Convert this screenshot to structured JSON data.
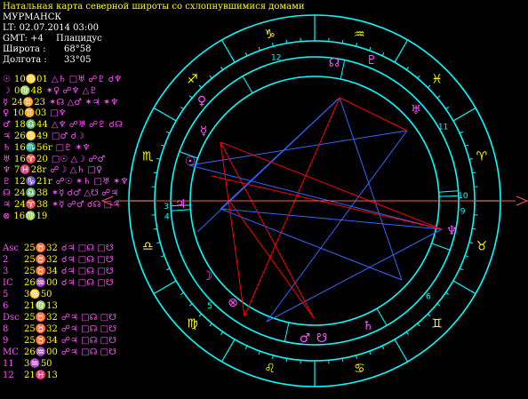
{
  "header": {
    "title": "Натальная карта северной широты со схлопнувшимися домами",
    "city": "МУРМАНСК",
    "local_time": "LT: 02.07.2014  03:00",
    "gmt": "GMT: +4",
    "house_system": "Плацидус",
    "latitude_label": "Широта :",
    "latitude_value": "68°58",
    "longitude_label": "Долгота :",
    "longitude_value": "33°05"
  },
  "planets": [
    {
      "glyph": "☉",
      "pos": "10♋01",
      "aspects": "△♄ □♅ ☍♇ ☌♆",
      "color": "#ff55ff"
    },
    {
      "glyph": "☽",
      "pos": "0♍48",
      "aspects": "✶♀ ☍♆ △♇",
      "color": "#ff55ff"
    },
    {
      "glyph": "☿",
      "pos": "24♊23",
      "aspects": "✶☊ △♂ ✶♃ ✶♆",
      "color": "#ff55ff"
    },
    {
      "glyph": "♀",
      "pos": "10♊03",
      "aspects": "□♆",
      "color": "#ff55ff"
    },
    {
      "glyph": "♂",
      "pos": "18♎44",
      "aspects": "△♆ ☍♅ ☍♇ ☌☊",
      "color": "#ff55ff"
    },
    {
      "glyph": "♃",
      "pos": "26♋49",
      "aspects": "□♂ ☌☽",
      "color": "#ff55ff"
    },
    {
      "glyph": "♄",
      "pos": "16♏56r",
      "aspects": "□♇ ✶♆",
      "color": "#ff55ff"
    },
    {
      "glyph": "♅",
      "pos": "16♈20",
      "aspects": "□☉ △☽ ☍♂",
      "color": "#ff55ff"
    },
    {
      "glyph": "♆",
      "pos": "7♓28r",
      "aspects": "☍☽ △♄ □♀",
      "color": "#ff55ff"
    },
    {
      "glyph": "♇",
      "pos": "12♑21r",
      "aspects": "☍☉ ✶♄ □♅ ✶♆",
      "color": "#ff55ff"
    },
    {
      "glyph": "☊",
      "pos": "24♎38",
      "aspects": "✶☿ ☌♂ △☋ ☍♃",
      "color": "#ff55ff"
    },
    {
      "glyph": "♃",
      "pos": "24♈38",
      "aspects": "✶☿ ☍♂ ☌☊ □♃",
      "color": "#ff55ff"
    },
    {
      "glyph": "⊗",
      "pos": "16♍19",
      "aspects": "",
      "color": "#ff55ff"
    }
  ],
  "cusps": [
    {
      "label": "Asc",
      "pos": "25♉32",
      "aspects": "☌♃ □☊ □☋"
    },
    {
      "label": "2",
      "pos": "25♉32",
      "aspects": "☌♃ □☊ □☋"
    },
    {
      "label": "3",
      "pos": "25♉34",
      "aspects": "☌♃ □☊ □☋"
    },
    {
      "label": "IC",
      "pos": "26♒00",
      "aspects": "☌♃ □☊ □☋"
    },
    {
      "label": "5",
      "pos": "3♋50",
      "aspects": ""
    },
    {
      "label": "6",
      "pos": "21♍13",
      "aspects": ""
    },
    {
      "label": "Dsc",
      "pos": "25♉32",
      "aspects": "☍♃ □☊ □☋"
    },
    {
      "label": "8",
      "pos": "25♉32",
      "aspects": "☍♃ □☊ □☋"
    },
    {
      "label": "9",
      "pos": "25♉34",
      "aspects": "☍♃ □☊ □☋"
    },
    {
      "label": "MC",
      "pos": "26♒00",
      "aspects": "☍♃ □☊ □☋"
    },
    {
      "label": "11",
      "pos": "3♒50",
      "aspects": ""
    },
    {
      "label": "12",
      "pos": "21♓13",
      "aspects": ""
    }
  ],
  "wheel": {
    "signs": [
      {
        "glyph": "♈",
        "lon": 15
      },
      {
        "glyph": "♓",
        "lon": 45
      },
      {
        "glyph": "♒",
        "lon": 75
      },
      {
        "glyph": "♑",
        "lon": 105
      },
      {
        "glyph": "♐",
        "lon": 135
      },
      {
        "glyph": "♏",
        "lon": 165
      },
      {
        "glyph": "♎",
        "lon": 195
      },
      {
        "glyph": "♍",
        "lon": 225
      },
      {
        "glyph": "♌",
        "lon": 255
      },
      {
        "glyph": "♋",
        "lon": 285
      },
      {
        "glyph": "♊",
        "lon": 315
      },
      {
        "glyph": "♉",
        "lon": 345
      }
    ],
    "houses": [
      {
        "num": "3"
      },
      {
        "num": "4"
      },
      {
        "num": "5"
      },
      {
        "num": "6"
      },
      {
        "num": "9"
      },
      {
        "num": "10"
      },
      {
        "num": "11"
      },
      {
        "num": "12"
      }
    ],
    "ring_planets": [
      {
        "glyph": "♅",
        "name": "uranus"
      },
      {
        "glyph": "☊",
        "name": "north-node"
      },
      {
        "glyph": "♇",
        "name": "pluto"
      },
      {
        "glyph": "♆",
        "name": "neptune"
      },
      {
        "glyph": "♄",
        "name": "saturn"
      },
      {
        "glyph": "☋",
        "name": "south-node"
      },
      {
        "glyph": "♂",
        "name": "mars"
      },
      {
        "glyph": "⊗",
        "name": "part-of-fortune"
      },
      {
        "glyph": "☽",
        "name": "moon"
      },
      {
        "glyph": "♃",
        "name": "jupiter"
      },
      {
        "glyph": "☉",
        "name": "sun"
      },
      {
        "glyph": "☿",
        "name": "mercury"
      },
      {
        "glyph": "♀",
        "name": "venus"
      }
    ]
  },
  "colors": {
    "ring": "#00ffff",
    "sign_glyph": "#ffff00",
    "planet_glyph": "#ff55ff",
    "house_number": "#00ffff",
    "cusp_label": "#ff55ff",
    "aspect_blue": "#3366ff",
    "aspect_red": "#ff0000",
    "axis_arrow": "#ff5555"
  }
}
